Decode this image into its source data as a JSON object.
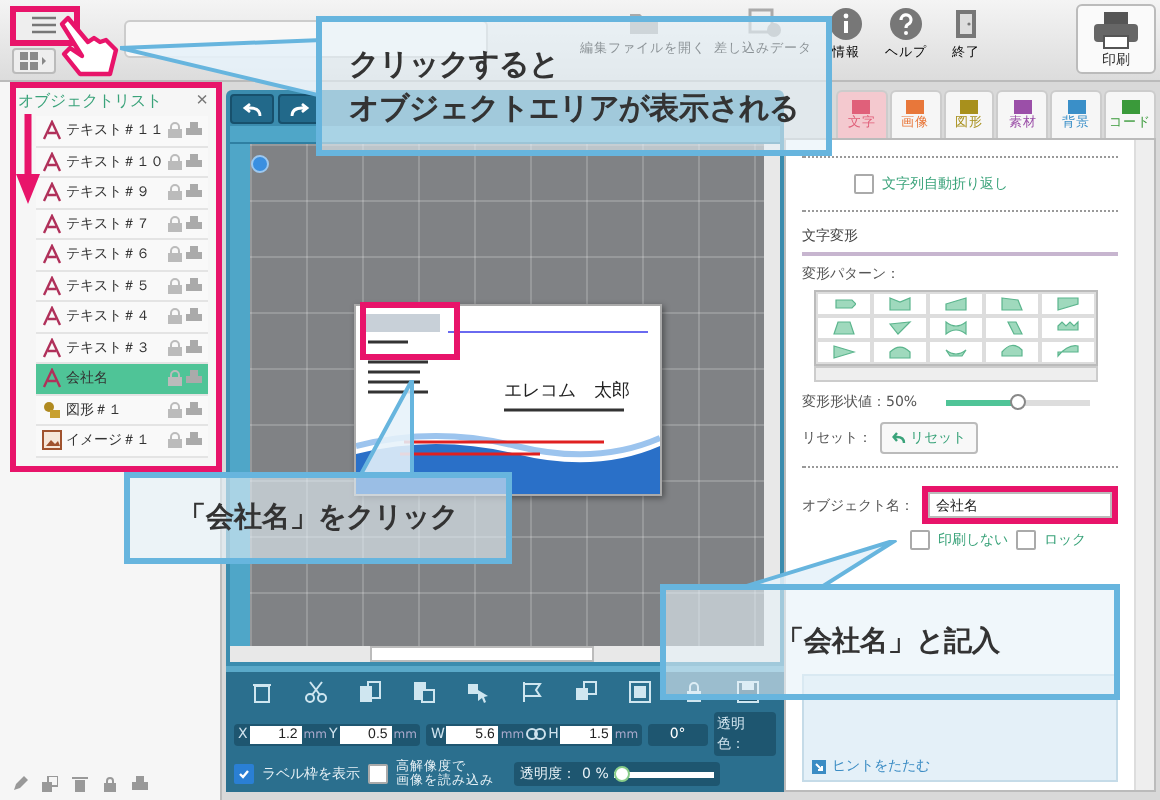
{
  "toolbar": {
    "items": [
      {
        "kind": "open",
        "label": "編集ファイルを開く"
      },
      {
        "kind": "merge",
        "label": "差し込みデータ"
      },
      {
        "kind": "info",
        "label": "情報"
      },
      {
        "kind": "help",
        "label": "ヘルプ"
      },
      {
        "kind": "exit",
        "label": "終了"
      }
    ],
    "print_button": "印刷"
  },
  "object_list": {
    "title": "オブジェクトリスト",
    "close": "×",
    "items": [
      {
        "kind": "text",
        "label": "テキスト＃１１",
        "selected": false
      },
      {
        "kind": "text",
        "label": "テキスト＃１０",
        "selected": false
      },
      {
        "kind": "text",
        "label": "テキスト＃９",
        "selected": false
      },
      {
        "kind": "text",
        "label": "テキスト＃７",
        "selected": false
      },
      {
        "kind": "text",
        "label": "テキスト＃６",
        "selected": false
      },
      {
        "kind": "text",
        "label": "テキスト＃５",
        "selected": false
      },
      {
        "kind": "text",
        "label": "テキスト＃４",
        "selected": false
      },
      {
        "kind": "text",
        "label": "テキスト＃３",
        "selected": false
      },
      {
        "kind": "text",
        "label": "会社名",
        "selected": true
      },
      {
        "kind": "shape",
        "label": "図形＃１",
        "selected": false
      },
      {
        "kind": "image",
        "label": "イメージ＃１",
        "selected": false
      }
    ]
  },
  "canvas": {
    "card": {
      "name": "エレコム　太郎"
    }
  },
  "bottom_toolbar": {
    "fields": [
      {
        "label": "X",
        "value": "1.2",
        "unit": "mm"
      },
      {
        "label": "Y",
        "value": "0.5",
        "unit": "mm"
      },
      {
        "label": "W",
        "value": "5.6",
        "unit": "mm"
      },
      {
        "label": "H",
        "value": "1.5",
        "unit": "mm"
      }
    ],
    "rotation": "0°",
    "transparent_color": "透明色：",
    "show_label_frame": {
      "label": "ラベル枠を表示",
      "checked": true
    },
    "high_res": {
      "lines": [
        "高解像度で",
        "画像を読み込み"
      ],
      "checked": false
    },
    "opacity": {
      "label": "透明度：",
      "value": "0",
      "unit": "%",
      "level": 0
    }
  },
  "right_panel": {
    "tabs": [
      {
        "label": "文字",
        "color": "#e0607a",
        "selected": true
      },
      {
        "label": "画像",
        "color": "#e8773a",
        "selected": false
      },
      {
        "label": "図形",
        "color": "#a8901c",
        "selected": false
      },
      {
        "label": "素材",
        "color": "#9b4fa8",
        "selected": false
      },
      {
        "label": "背景",
        "color": "#3a8fc8",
        "selected": false
      },
      {
        "label": "コード",
        "color": "#3a9a3a",
        "selected": false
      }
    ],
    "wrap_text": {
      "label": "文字列自動折り返し",
      "checked": false
    },
    "transform": {
      "heading": "文字変形",
      "pattern_label": "変形パターン：",
      "value_label": "変形形状値：50%",
      "level": 0.5,
      "reset_label": "リセット：",
      "reset_button": "リセット"
    },
    "object_name": {
      "label": "オブジェクト名：",
      "value": "会社名"
    },
    "no_print": {
      "label": "印刷しない",
      "checked": false
    },
    "lock": {
      "label": "ロック",
      "checked": false
    },
    "hint_toggle": "ヒントをたたむ"
  },
  "callouts": [
    {
      "kind": "top",
      "lines": [
        "クリックすると",
        "オブジェクトエリアが表示される"
      ]
    },
    {
      "kind": "left",
      "lines": [
        "「会社名」をクリック"
      ]
    },
    {
      "kind": "right",
      "lines": [
        "「会社名」と記入"
      ]
    }
  ]
}
